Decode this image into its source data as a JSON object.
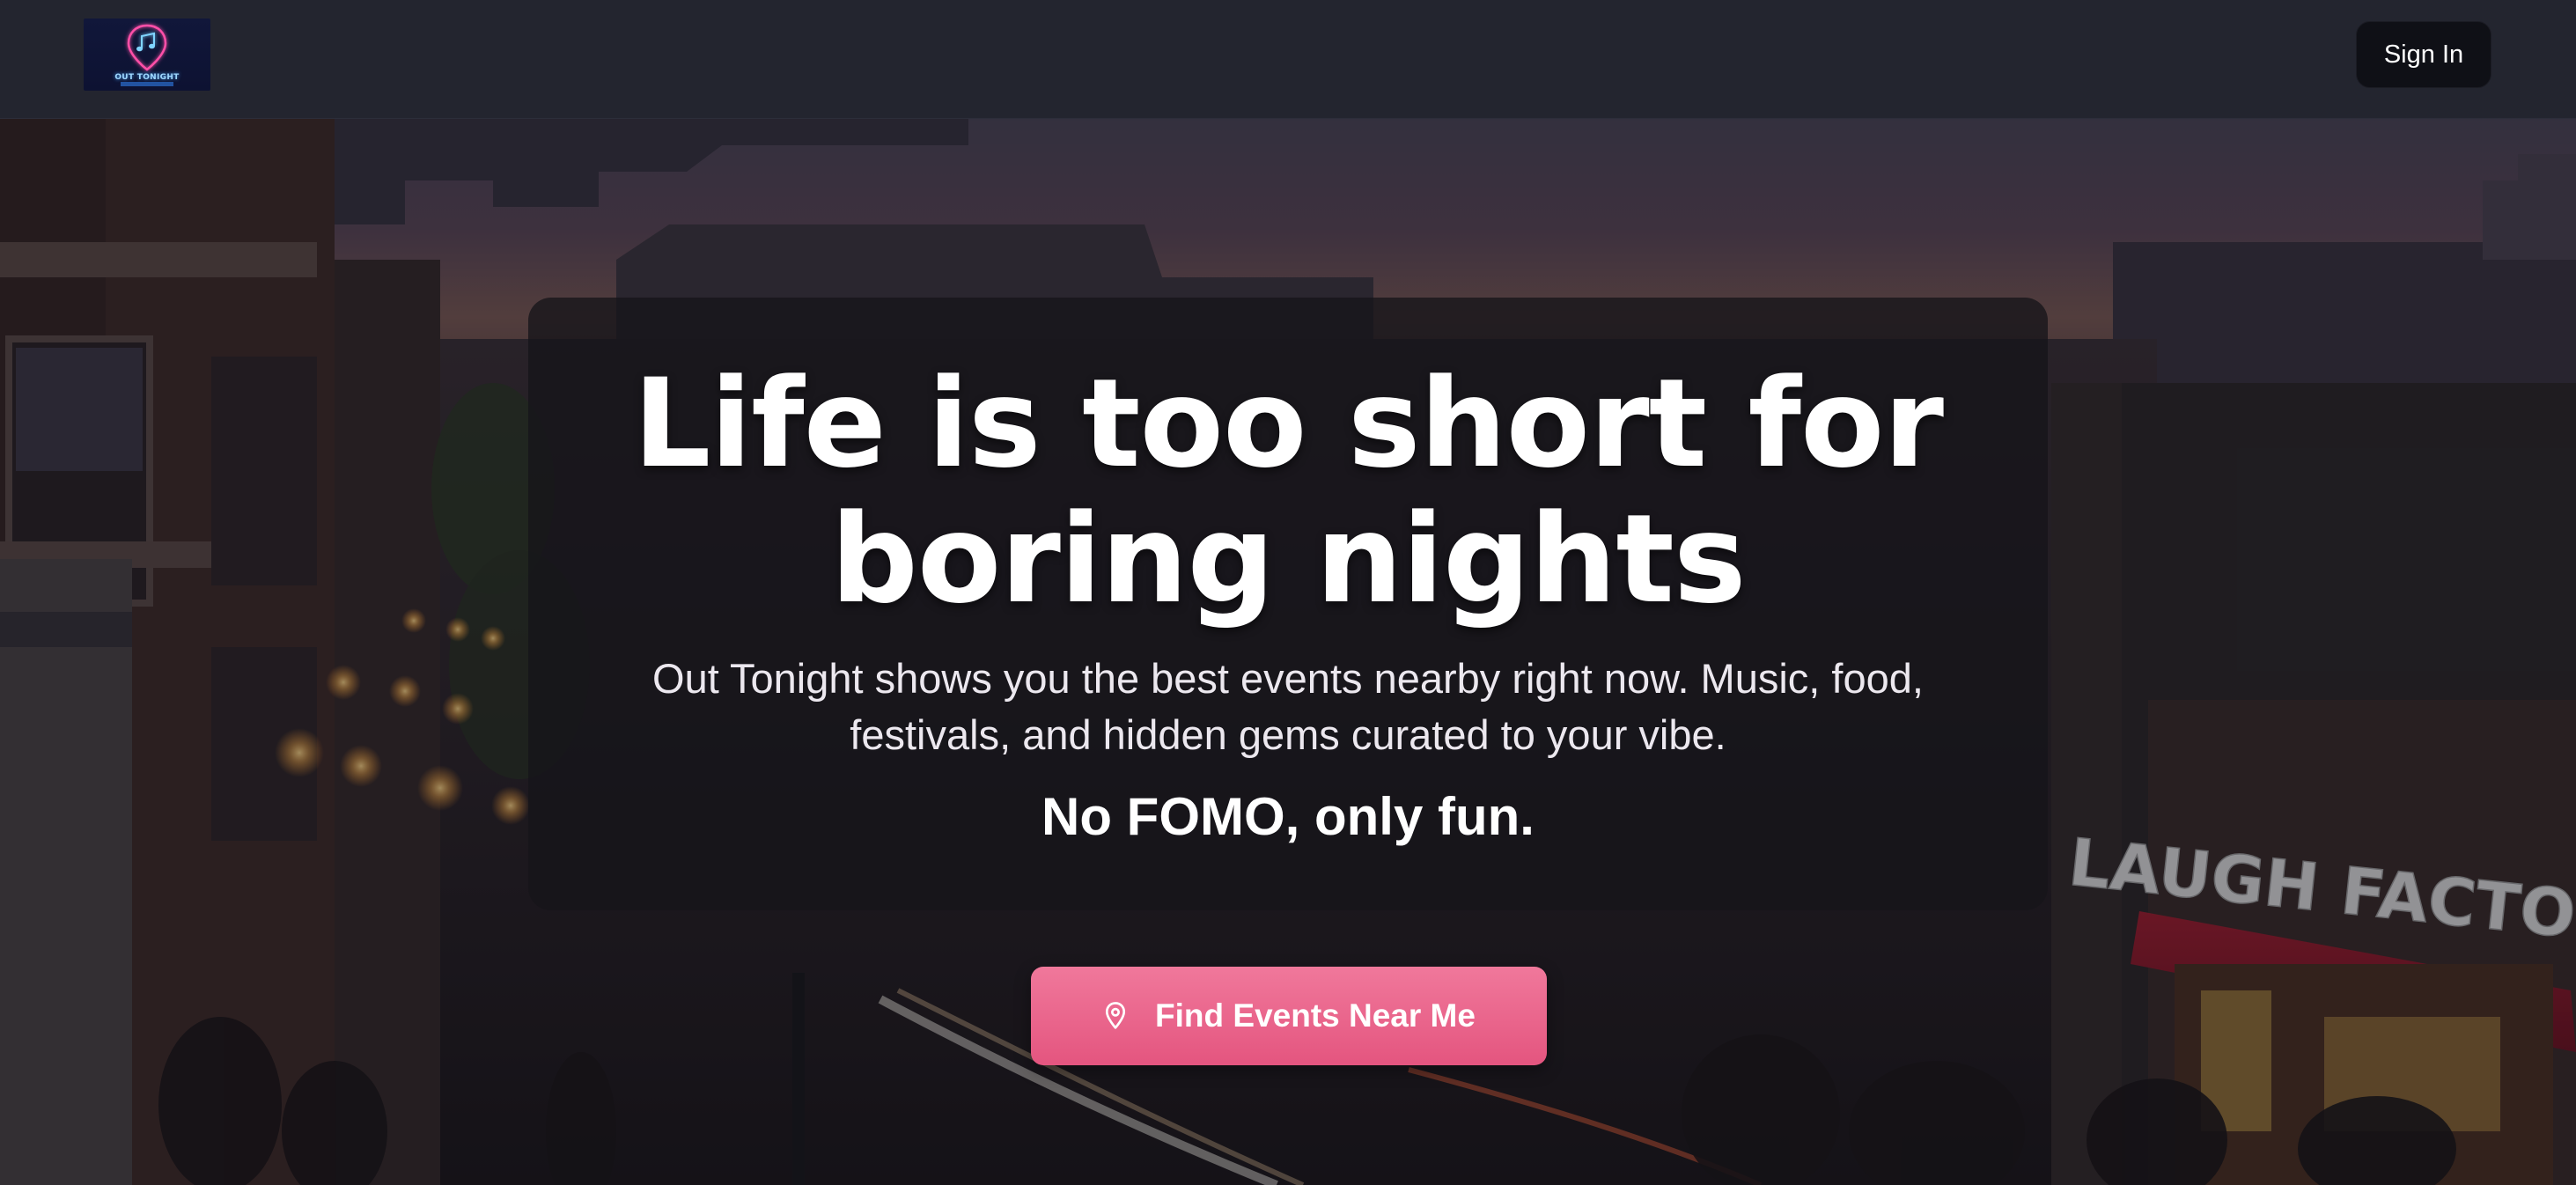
{
  "header": {
    "logo_text": "OUT TONIGHT",
    "sign_in_label": "Sign In"
  },
  "hero": {
    "headline_line1": "Life is too short for",
    "headline_line2": "boring nights",
    "subtitle_line1": "Out Tonight shows you the best events nearby right now. Music, food,",
    "subtitle_line2": "festivals, and hidden gems curated to your vibe.",
    "tagline": "No FOMO, only fun.",
    "cta_label": "Find Events Near Me",
    "cta_icon": "map-pin-icon",
    "sign_text": "LAUGH FACTORY"
  },
  "colors": {
    "header_bg": "#23252f",
    "cta_pink": "#e8628a",
    "signin_bg": "#0f1016"
  }
}
